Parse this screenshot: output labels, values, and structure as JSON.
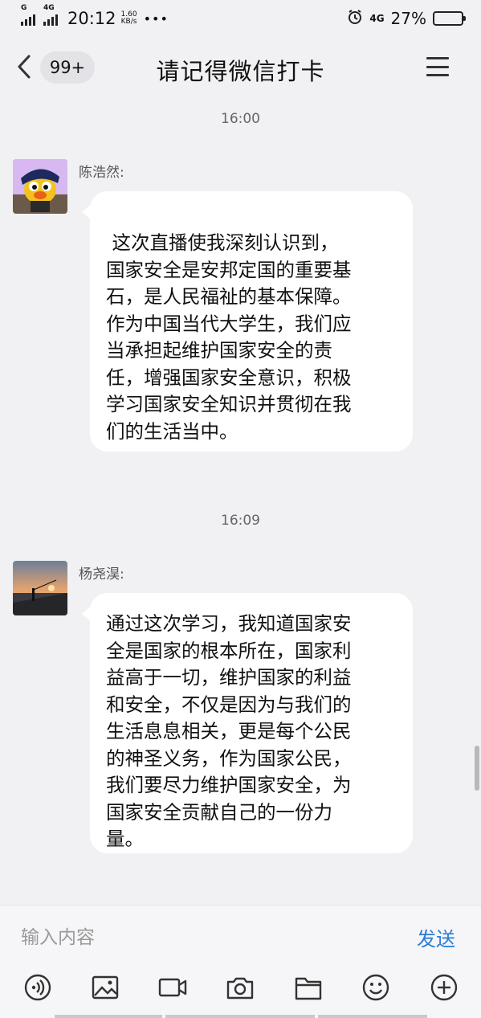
{
  "status_bar": {
    "signal_1_label": "G",
    "signal_2_label": "4G",
    "time": "20:12",
    "speed_value": "1.60",
    "speed_unit": "KB/s",
    "more_dots": "•••",
    "network_label": "4G",
    "battery_percent": "27%",
    "battery_level": 0.27
  },
  "header": {
    "unread_badge": "99+",
    "title": "请记得微信打卡"
  },
  "messages": [
    {
      "time": "16:00",
      "sender": "陈浩然:",
      "lines": [
        " 这次直播使我深刻认识到，",
        "国家安全是安邦定国的重要基",
        "石，是人民福祉的基本保障。",
        "作为中国当代大学生，我们应",
        "当承担起维护国家安全的责",
        "任，增强国家安全意识，积极",
        "学习国家安全知识并贯彻在我",
        "们的生活当中。"
      ]
    },
    {
      "time": "16:09",
      "sender": "杨尧淏:",
      "lines": [
        "通过这次学习，我知道国家安",
        "全是国家的根本所在，国家利",
        "益高于一切，维护国家的利益",
        "和安全，不仅是因为与我们的",
        "生活息息相关，更是每个公民",
        "的神圣义务，作为国家公民，",
        "我们要尽力维护国家安全，为",
        "国家安全贡献自己的一份力",
        "量。"
      ]
    }
  ],
  "input": {
    "placeholder": "输入内容",
    "send_label": "发送"
  },
  "toolbar_icons": [
    "voice-icon",
    "image-icon",
    "video-icon",
    "camera-icon",
    "folder-icon",
    "emoji-icon",
    "plus-icon"
  ],
  "colors": {
    "background": "#f1f1f3",
    "bubble": "#ffffff",
    "send_accent": "#2a7bd6",
    "badge_bg": "#e3e3e7"
  }
}
